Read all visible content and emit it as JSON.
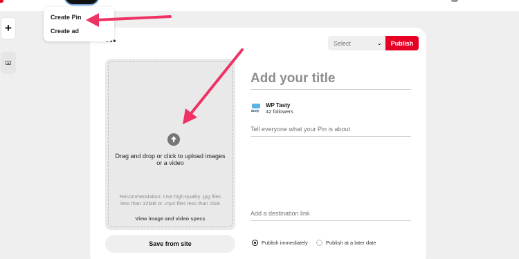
{
  "menu": {
    "items": [
      "Create Pin",
      "Create ad"
    ]
  },
  "sidebar": {
    "add_label": "+",
    "add_icon": "plus-icon",
    "images_icon": "image-icon"
  },
  "toolbar": {
    "more_label": "•••",
    "select_placeholder": "Select",
    "select_chevron": "⌄",
    "publish_label": "Publish"
  },
  "upload": {
    "icon": "upload-arrow-icon",
    "instruction": "Drag and drop or click to upload images or a video",
    "recommendation": "Recommendation: Use high-quality .jpg files less than 32MB or .mp4 files less than 2GB",
    "specs_link": "View image and video specs",
    "save_from_site": "Save from site"
  },
  "form": {
    "title_placeholder": "Add your title",
    "account_name": "WP Tasty",
    "account_logo_text": "tasty",
    "followers": "42 followers",
    "description_placeholder": "Tell everyone what your Pin is about",
    "link_placeholder": "Add a destination link"
  },
  "publish_options": {
    "immediately": "Publish immediately",
    "later": "Publish at a later date",
    "selected": "immediately"
  },
  "colors": {
    "brand_red": "#e60023",
    "annotation_arrow": "#ee3364"
  }
}
